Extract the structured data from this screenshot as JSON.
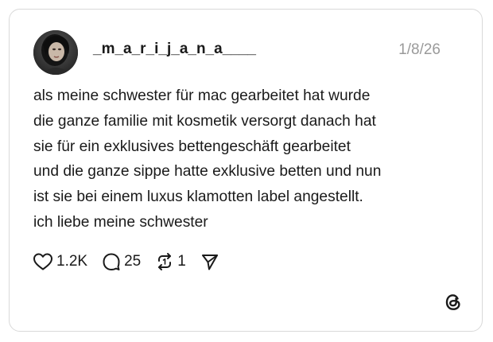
{
  "post": {
    "username": "_m_a_r_i_j_a_n_a____",
    "timestamp": "1/8/26",
    "text_lines": [
      "als meine schwester für mac gearbeitet hat wurde",
      "die ganze familie mit kosmetik versorgt danach hat",
      "sie für ein exklusives bettengeschäft gearbeitet",
      "und die ganze sippe hatte exklusive betten und nun",
      "ist sie bei einem luxus klamotten label angestellt.",
      "ich liebe meine schwester"
    ]
  },
  "actions": {
    "likes": "1.2K",
    "replies": "25",
    "reposts": "1"
  },
  "icons": {
    "like": "heart-icon",
    "reply": "speech-bubble-icon",
    "repost": "repost-arrows-icon",
    "share": "paper-plane-icon",
    "brand": "threads-logo-icon"
  },
  "colors": {
    "text": "#1a1a1a",
    "muted": "#9a9a9a",
    "border": "#d9d9d9"
  }
}
